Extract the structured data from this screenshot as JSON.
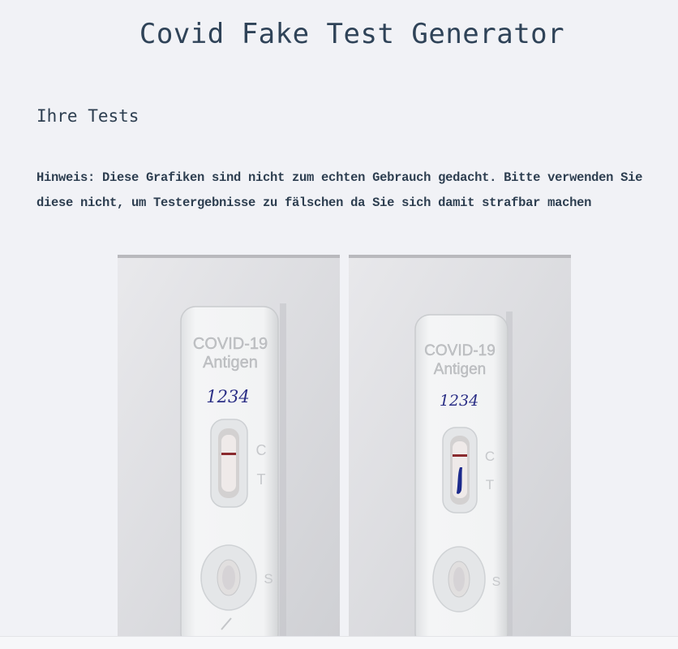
{
  "page": {
    "title": "Covid Fake Test Generator",
    "section_heading": "Ihre Tests",
    "notice": "Hinweis: Diese Grafiken sind nicht zum echten Gebrauch gedacht. Bitte verwenden Sie diese nicht, um Testergebnisse zu fälschen da Sie sich damit strafbar machen"
  },
  "tests": [
    {
      "brand_line1": "COVID-19",
      "brand_line2": "Antigen",
      "number": "1234",
      "label_c": "C",
      "label_t": "T",
      "label_s": "S",
      "result": "negative"
    },
    {
      "brand_line1": "COVID-19",
      "brand_line2": "Antigen",
      "number": "1234",
      "label_c": "C",
      "label_t": "T",
      "label_s": "S",
      "result": "positive"
    }
  ],
  "colors": {
    "title": "#2f4358",
    "text": "#2d3e50",
    "background": "#f1f2f6",
    "control_line": "#8a2a2e",
    "test_line": "#1d2a8c",
    "ink": "#2b2f86"
  }
}
